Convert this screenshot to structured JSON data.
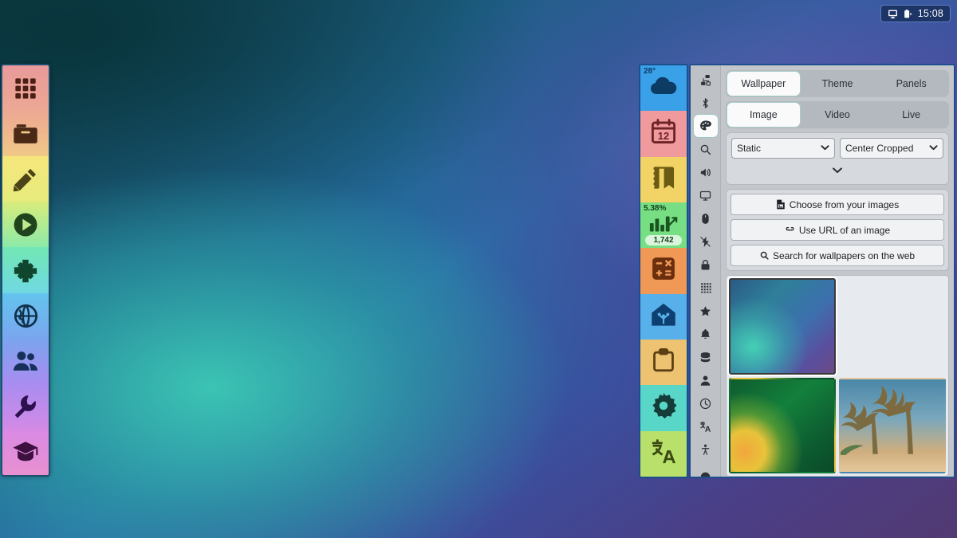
{
  "statusbar": {
    "display_icon": "display-icon",
    "battery_icon": "battery-charging-icon",
    "clock": "15:08"
  },
  "dock": {
    "name": "app-dock",
    "items": [
      {
        "icon": "apps-grid-icon",
        "label": "Applications",
        "bg_top": "#e89a9a",
        "bg_bottom": "#f0b39b",
        "fg": "#4a2016"
      },
      {
        "icon": "folder-icon",
        "label": "Files",
        "bg_top": "#f0b39b",
        "bg_bottom": "#f2d17e",
        "fg": "#4a2e16"
      },
      {
        "icon": "pencil-icon",
        "label": "Editor",
        "bg_top": "#f6e37a",
        "bg_bottom": "#e0ec7c",
        "fg": "#4a4416"
      },
      {
        "icon": "play-icon",
        "label": "Media Player",
        "bg_top": "#d9ec7c",
        "bg_bottom": "#8ceaa8",
        "fg": "#20441c"
      },
      {
        "icon": "gamepad-icon",
        "label": "Games",
        "bg_top": "#73e7b4",
        "bg_bottom": "#6fd8e2",
        "fg": "#10452e"
      },
      {
        "icon": "globe-icon",
        "label": "Browser",
        "bg_top": "#63c4ee",
        "bg_bottom": "#7aa6ef",
        "fg": "#10304a"
      },
      {
        "icon": "users-icon",
        "label": "Contacts",
        "bg_top": "#7ba4ef",
        "bg_bottom": "#a98df0",
        "fg": "#15305a"
      },
      {
        "icon": "wrench-icon",
        "label": "Tools",
        "bg_top": "#a98df0",
        "bg_bottom": "#d38ae6",
        "fg": "#2d1050"
      },
      {
        "icon": "graduation-icon",
        "label": "Learn",
        "bg_top": "#d98ae4",
        "bg_bottom": "#e890d0",
        "fg": "#3d1040"
      }
    ]
  },
  "widgets": {
    "name": "widget-strip",
    "items": [
      {
        "icon": "cloud-icon",
        "label": "Weather",
        "corner": "28°",
        "pill": "",
        "bg": "#3aa0e8",
        "fg": "#0c3b63",
        "corner_color": "#0c3b63"
      },
      {
        "icon": "calendar-icon",
        "label": "Calendar",
        "corner": "",
        "pill": "",
        "bg": "#f09a9e",
        "fg": "#6e2325",
        "day": "12"
      },
      {
        "icon": "notebook-icon",
        "label": "Notes",
        "corner": "",
        "pill": "",
        "bg": "#f2d365",
        "fg": "#6b5a13"
      },
      {
        "icon": "chart-icon",
        "label": "Stocks",
        "corner": "5.38%",
        "pill": "1,742",
        "bg": "#77de83",
        "fg": "#18551f",
        "corner_color": "#12421a"
      },
      {
        "icon": "calculator-icon",
        "label": "Calculator",
        "corner": "",
        "pill": "",
        "bg": "#f09855",
        "fg": "#6b2f0e"
      },
      {
        "icon": "smart-home-icon",
        "label": "Smart Home",
        "corner": "",
        "pill": "",
        "bg": "#58b0ea",
        "fg": "#0d3f70"
      },
      {
        "icon": "clipboard-icon",
        "label": "Tasks",
        "corner": "",
        "pill": "",
        "bg": "#edc271",
        "fg": "#5c3f12"
      },
      {
        "icon": "gear-icon",
        "label": "Settings",
        "corner": "",
        "pill": "",
        "bg": "#58d6c8",
        "fg": "#143c38"
      },
      {
        "icon": "translate-icon",
        "label": "Translate",
        "corner": "",
        "pill": "",
        "bg": "#b9e06a",
        "fg": "#3b4a12"
      }
    ]
  },
  "panel": {
    "name": "appearance-settings-panel",
    "icon_rail": [
      {
        "icon": "network-icon",
        "label": "Network",
        "active": false
      },
      {
        "icon": "bluetooth-icon",
        "label": "Bluetooth",
        "active": false
      },
      {
        "icon": "palette-icon",
        "label": "Appearance",
        "active": true
      },
      {
        "icon": "search-icon",
        "label": "Search",
        "active": false
      },
      {
        "icon": "sound-icon",
        "label": "Sound",
        "active": false
      },
      {
        "icon": "display-icon",
        "label": "Display",
        "active": false
      },
      {
        "icon": "mouse-icon",
        "label": "Mouse",
        "active": false
      },
      {
        "icon": "power-icon",
        "label": "Power",
        "active": false
      },
      {
        "icon": "lock-icon",
        "label": "Privacy",
        "active": false
      },
      {
        "icon": "apps-grid-icon",
        "label": "Applications",
        "active": false
      },
      {
        "icon": "star-icon",
        "label": "Favorites",
        "active": false
      },
      {
        "icon": "bell-icon",
        "label": "Notifications",
        "active": false
      },
      {
        "icon": "database-icon",
        "label": "Storage",
        "active": false
      },
      {
        "icon": "user-icon",
        "label": "Users",
        "active": false
      },
      {
        "icon": "clock-icon",
        "label": "Date & Time",
        "active": false
      },
      {
        "icon": "translate-icon",
        "label": "Language",
        "active": false
      },
      {
        "icon": "accessibility-icon",
        "label": "Accessibility",
        "active": false
      },
      {
        "icon": "about-icon",
        "label": "About",
        "active": false
      }
    ],
    "primary_tabs": [
      {
        "label": "Wallpaper",
        "selected": true
      },
      {
        "label": "Theme",
        "selected": false
      },
      {
        "label": "Panels",
        "selected": false
      }
    ],
    "secondary_tabs": [
      {
        "label": "Image",
        "selected": true
      },
      {
        "label": "Video",
        "selected": false
      },
      {
        "label": "Live",
        "selected": false
      }
    ],
    "selects": [
      {
        "name": "wallpaper-mode-select",
        "value": "Static",
        "chevron": "chevron-down-icon"
      },
      {
        "name": "wallpaper-fit-select",
        "value": "Center Cropped",
        "chevron": "chevron-down-icon"
      }
    ],
    "expander_icon": "chevron-down-icon",
    "actions": [
      {
        "icon": "file-image-icon",
        "label": "Choose from your images"
      },
      {
        "icon": "link-icon",
        "label": "Use URL of an image"
      },
      {
        "icon": "search-icon",
        "label": "Search for wallpapers on the web"
      }
    ],
    "gallery": {
      "name": "wallpaper-gallery",
      "thumbs": [
        {
          "name": "wallpaper-thumb-gradient-blue",
          "style": "tb-1",
          "selected": true,
          "alt": "Teal to purple gradient"
        },
        {
          "name": "wallpaper-thumb-gradient-dark",
          "style": "tb-2",
          "selected": false,
          "alt": "Dark green and gold gradient"
        },
        {
          "name": "wallpaper-thumb-gradient-green",
          "style": "tb-3",
          "selected": false,
          "alt": "Green and orange gradient"
        },
        {
          "name": "wallpaper-thumb-palm-trees",
          "style": "tb-4",
          "selected": false,
          "alt": "Palm trees at dusk"
        }
      ]
    }
  },
  "colors": {
    "accent": "#9fc9c4",
    "panel_bg": "#c3c7cc",
    "panel_border": "#1d4f8e",
    "dock_border": "#1d4f6e",
    "statusbar_bg": "#1d3566"
  }
}
